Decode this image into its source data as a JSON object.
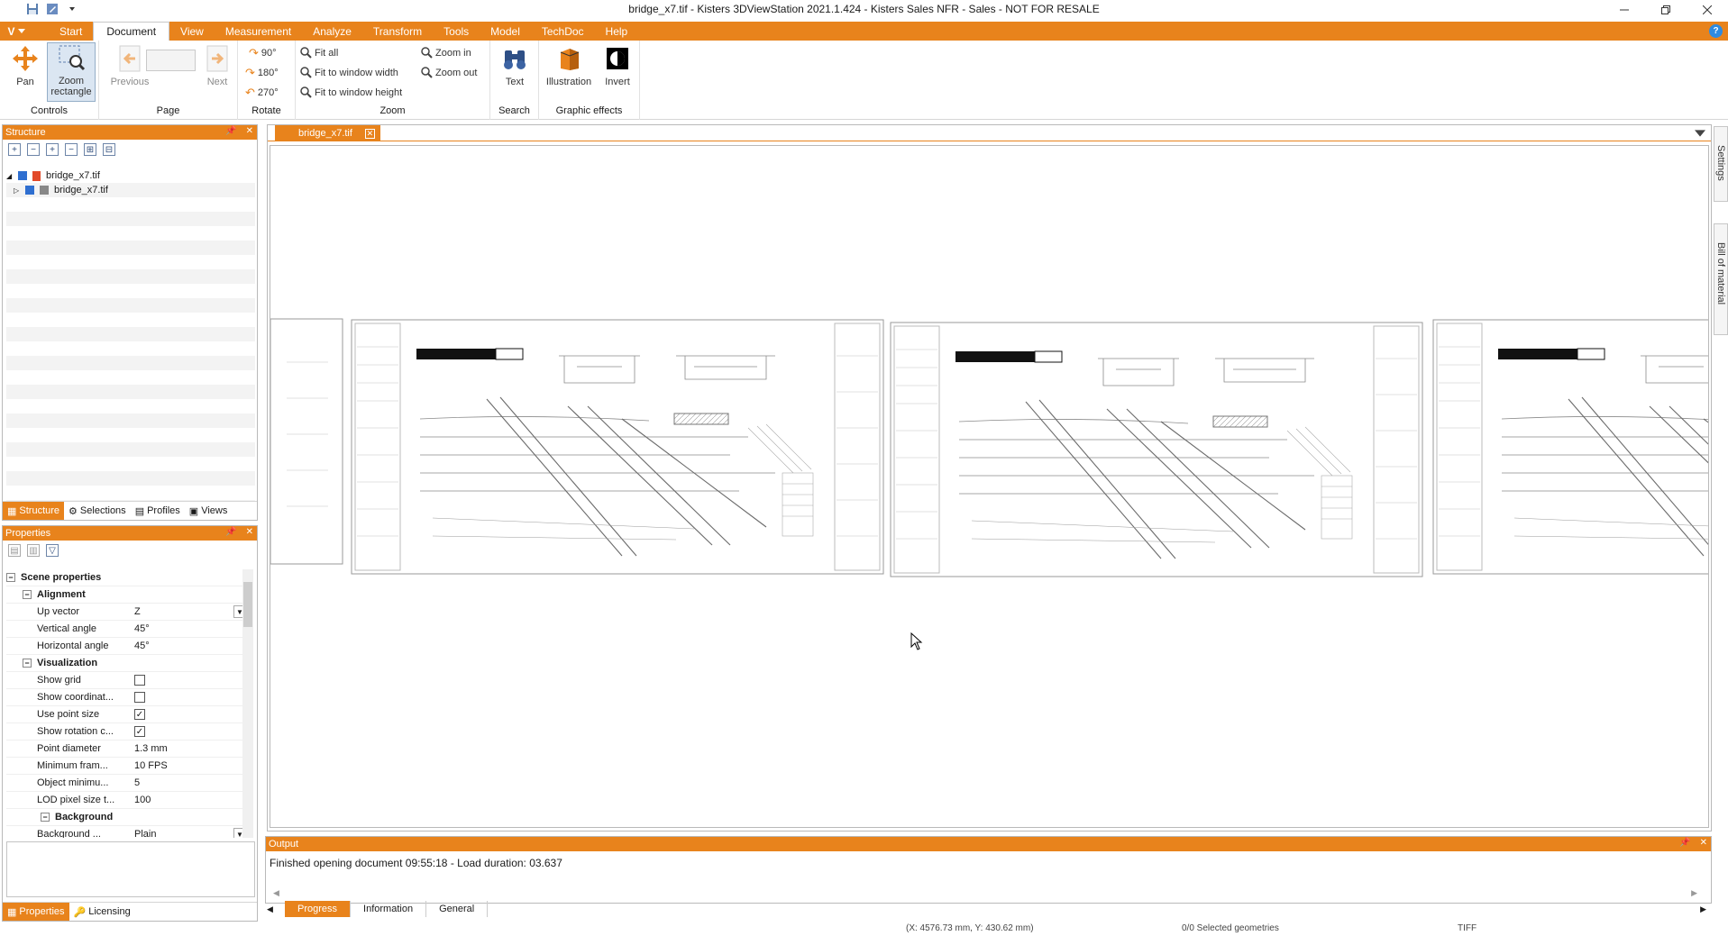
{
  "window": {
    "title": "bridge_x7.tif - Kisters 3DViewStation 2021.1.424 - Kisters Sales NFR - Sales - NOT FOR RESALE",
    "minimize_icon": "minimize-icon",
    "restore_icon": "restore-icon",
    "close_icon": "close-icon"
  },
  "menu": {
    "app_button": "V",
    "tabs": [
      "Start",
      "Document",
      "View",
      "Measurement",
      "Analyze",
      "Transform",
      "Tools",
      "Model",
      "TechDoc",
      "Help"
    ],
    "active_tab": "Document"
  },
  "ribbon": {
    "controls": {
      "label": "Controls",
      "pan": "Pan",
      "zoom_rectangle": "Zoom rectangle"
    },
    "page": {
      "label": "Page",
      "previous": "Previous",
      "next": "Next"
    },
    "rotate": {
      "label": "Rotate",
      "r90": "90°",
      "r180": "180°",
      "r270": "270°"
    },
    "zoom": {
      "label": "Zoom",
      "fit_all": "Fit all",
      "fit_width": "Fit to window width",
      "fit_height": "Fit to window height",
      "zoom_in": "Zoom in",
      "zoom_out": "Zoom out"
    },
    "search": {
      "label": "Search",
      "text": "Text"
    },
    "graphic_effects": {
      "label": "Graphic effects",
      "illustration": "Illustration",
      "invert": "Invert"
    }
  },
  "structure_panel": {
    "title": "Structure",
    "tree": [
      {
        "label": "bridge_x7.tif",
        "level": 0
      },
      {
        "label": "bridge_x7.tif",
        "level": 1
      }
    ],
    "tabs": [
      "Structure",
      "Selections",
      "Profiles",
      "Views"
    ],
    "active_tab": "Structure"
  },
  "properties_panel": {
    "title": "Properties",
    "scene_properties": "Scene properties",
    "alignment": "Alignment",
    "up_vector": {
      "label": "Up vector",
      "value": "Z"
    },
    "vertical_angle": {
      "label": "Vertical angle",
      "value": "45°"
    },
    "horizontal_angle": {
      "label": "Horizontal angle",
      "value": "45°"
    },
    "visualization": "Visualization",
    "show_grid": {
      "label": "Show grid",
      "checked": false
    },
    "show_coordinate": {
      "label": "Show coordinat...",
      "checked": false
    },
    "use_point_size": {
      "label": "Use point size",
      "checked": true
    },
    "show_rotation": {
      "label": "Show rotation c...",
      "checked": true
    },
    "point_diameter": {
      "label": "Point diameter",
      "value": "1.3 mm"
    },
    "minimum_frame": {
      "label": "Minimum fram...",
      "value": "10 FPS"
    },
    "object_minimum": {
      "label": "Object minimu...",
      "value": "5"
    },
    "lod_pixel": {
      "label": "LOD pixel size t...",
      "value": "100"
    },
    "background": "Background",
    "background_type": {
      "label": "Background ...",
      "value": "Plain"
    },
    "tabs": [
      "Properties",
      "Licensing"
    ],
    "active_tab": "Properties"
  },
  "document": {
    "tab_label": "bridge_x7.tif"
  },
  "side_tabs": [
    "Settings",
    "Bill of material"
  ],
  "output_panel": {
    "title": "Output",
    "message": "Finished opening document 09:55:18 - Load duration: 03.637",
    "tabs": [
      "Progress",
      "Information",
      "General"
    ],
    "active_tab": "Progress"
  },
  "statusbar": {
    "coordinates": "(X: 4576.73 mm, Y: 430.62 mm)",
    "selection": "0/0 Selected geometries",
    "format": "TIFF"
  },
  "colors": {
    "accent": "#e8831c",
    "panel_border": "#b9b9b9"
  }
}
